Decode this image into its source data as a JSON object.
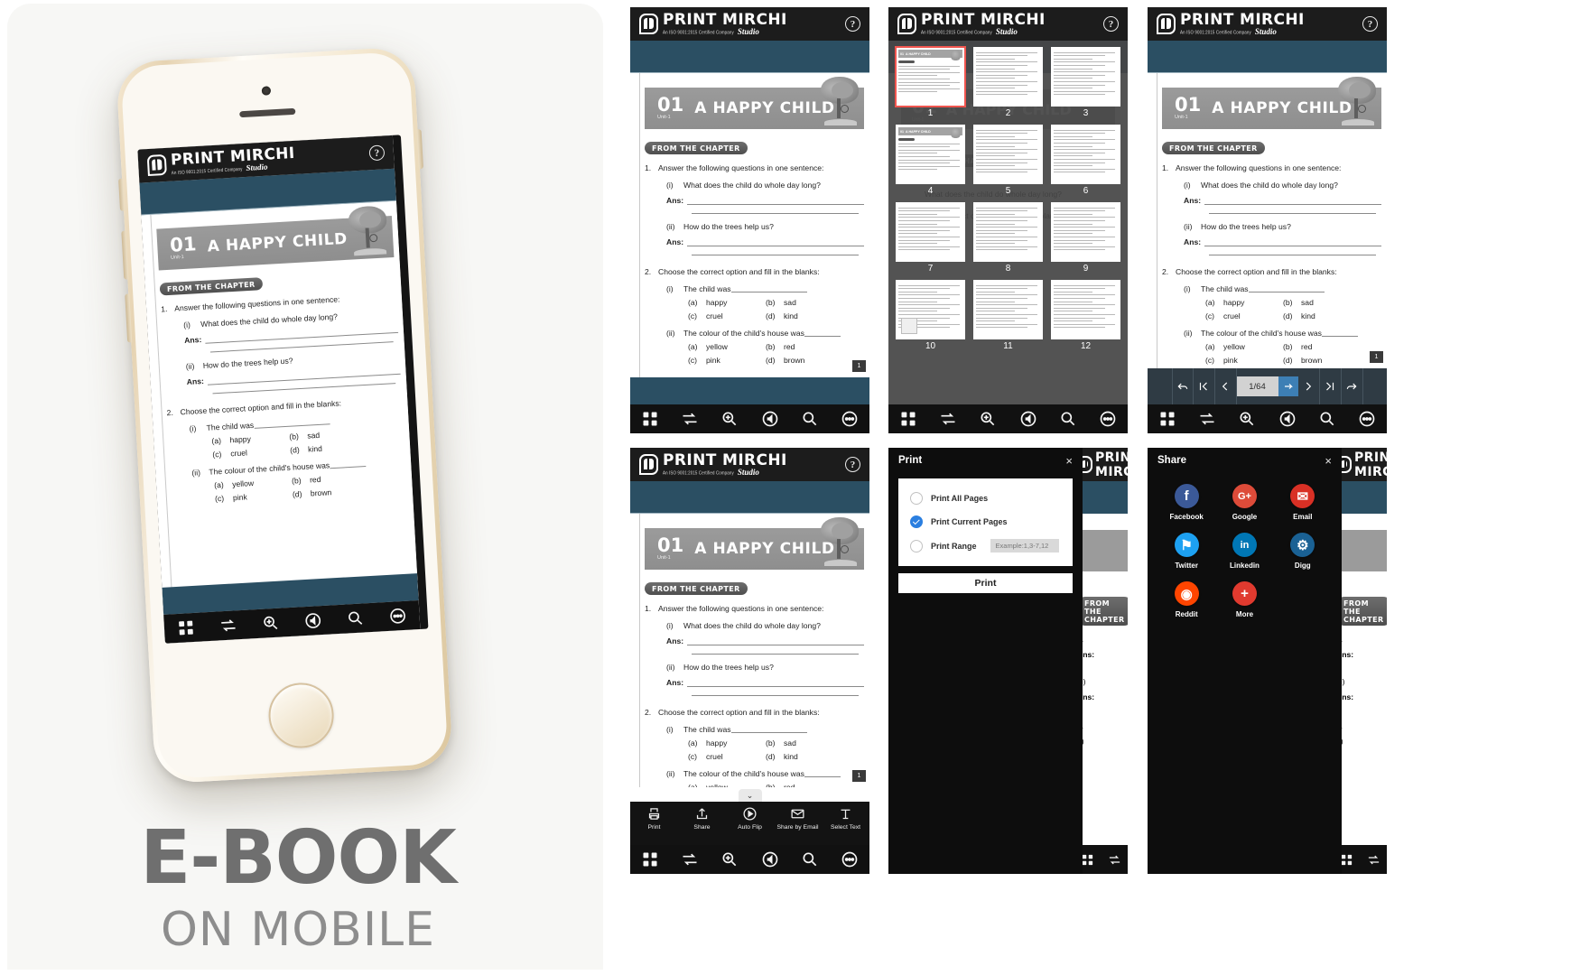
{
  "promo": {
    "title": "E-BOOK",
    "subtitle": "ON MOBILE"
  },
  "brand": {
    "name": "PRINT MIRCHI",
    "iso": "An ISO 9001:2015 Certified Company",
    "studio": "Studio",
    "help_icon": "?",
    "accent_blue": "#2b4f63",
    "topbar_black": "#1c1c1c",
    "highlight_red": "#f0554f"
  },
  "worksheet": {
    "chapter_number": "01",
    "unit_label": "Unit-1",
    "chapter_title": "A HAPPY CHILD",
    "section_pill": "FROM THE CHAPTER",
    "q1": {
      "num": "1.",
      "text": "Answer the following questions in one sentence:",
      "items": [
        {
          "marker": "(i)",
          "text": "What does the child do whole day long?",
          "ans_label": "Ans:"
        },
        {
          "marker": "(ii)",
          "text": "How do the trees help us?",
          "ans_label": "Ans:"
        }
      ]
    },
    "q2": {
      "num": "2.",
      "text": "Choose the correct option and fill in the blanks:",
      "items": [
        {
          "marker": "(i)",
          "stem": "The child was",
          "tail": ".",
          "options": [
            {
              "key": "(a)",
              "label": "happy"
            },
            {
              "key": "(b)",
              "label": "sad"
            },
            {
              "key": "(c)",
              "label": "cruel"
            },
            {
              "key": "(d)",
              "label": "kind"
            }
          ]
        },
        {
          "marker": "(ii)",
          "stem": "The colour of the child's house was",
          "tail": ".",
          "options": [
            {
              "key": "(a)",
              "label": "yellow"
            },
            {
              "key": "(b)",
              "label": "red"
            },
            {
              "key": "(c)",
              "label": "pink"
            },
            {
              "key": "(d)",
              "label": "brown"
            }
          ]
        }
      ]
    },
    "page_number": "1"
  },
  "toolbar": {
    "items": [
      {
        "name": "grid-view-icon",
        "label": "Grid"
      },
      {
        "name": "flip-pages-icon",
        "label": "Flip"
      },
      {
        "name": "zoom-in-icon",
        "label": "Zoom"
      },
      {
        "name": "sound-icon",
        "label": "Sound"
      },
      {
        "name": "search-icon",
        "label": "Search"
      },
      {
        "name": "more-options-icon",
        "label": "More"
      }
    ]
  },
  "toolbar_labeled": {
    "items": [
      {
        "name": "print-icon",
        "label": "Print"
      },
      {
        "name": "share-icon",
        "label": "Share"
      },
      {
        "name": "auto-flip-icon",
        "label": "Auto Flip"
      },
      {
        "name": "share-by-email-icon",
        "label": "Share by Email"
      },
      {
        "name": "select-text-icon",
        "label": "Select Text"
      }
    ],
    "collapse_chevron": "⌄"
  },
  "thumbnails": {
    "selected_page": "1",
    "pages": [
      "1",
      "2",
      "3",
      "4",
      "5",
      "6",
      "7",
      "8",
      "9",
      "10",
      "11",
      "12"
    ]
  },
  "page_nav": {
    "current": "1/64",
    "buttons": [
      {
        "name": "undo-icon",
        "label": "Undo"
      },
      {
        "name": "first-page-icon",
        "label": "First Page"
      },
      {
        "name": "previous-page-icon",
        "label": "Previous Page"
      },
      {
        "name": "go-icon",
        "label": "Go"
      },
      {
        "name": "next-page-icon",
        "label": "Next Page"
      },
      {
        "name": "last-page-icon",
        "label": "Last Page"
      },
      {
        "name": "redo-icon",
        "label": "Redo"
      }
    ]
  },
  "print_dialog": {
    "title": "Print",
    "close": "×",
    "options": [
      {
        "label": "Print All Pages",
        "selected": false
      },
      {
        "label": "Print Current Pages",
        "selected": true
      },
      {
        "label": "Print Range",
        "selected": false
      }
    ],
    "range_placeholder": "Example:1,3-7,12",
    "submit_label": "Print"
  },
  "share_dialog": {
    "title": "Share",
    "close": "×",
    "targets": [
      {
        "label": "Facebook",
        "glyph": "f",
        "color": "#3b5998",
        "icon_name": "facebook-icon"
      },
      {
        "label": "Google",
        "glyph": "G+",
        "color": "#dd4b39",
        "icon_name": "google-plus-icon"
      },
      {
        "label": "Email",
        "glyph": "✉",
        "color": "#d93025",
        "icon_name": "email-icon"
      },
      {
        "label": "Twitter",
        "glyph": "⚑",
        "color": "#1da1f2",
        "icon_name": "twitter-icon"
      },
      {
        "label": "Linkedin",
        "glyph": "in",
        "color": "#0077b5",
        "icon_name": "linkedin-icon"
      },
      {
        "label": "Digg",
        "glyph": "⚙",
        "color": "#1a6194",
        "icon_name": "digg-icon"
      },
      {
        "label": "Reddit",
        "glyph": "◉",
        "color": "#ff4500",
        "icon_name": "reddit-icon"
      },
      {
        "label": "More",
        "glyph": "+",
        "color": "#e03a2f",
        "icon_name": "more-icon"
      }
    ]
  }
}
